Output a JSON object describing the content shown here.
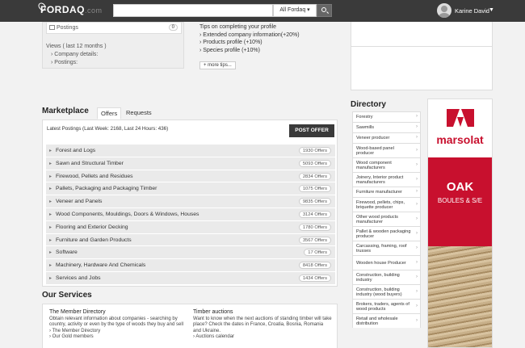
{
  "header": {
    "logo": "FORDAQ",
    "logo_domain": ".com",
    "search_placeholder": "",
    "search_scope": "All Fordaq",
    "user_name": "Karine David"
  },
  "profile": {
    "postings_label": "Postings",
    "postings_count": "0",
    "views_title": "Views ( last 12 months )",
    "views_items": [
      "Company details:",
      "Postings:"
    ]
  },
  "tips": {
    "title": "Tips on completing your profile",
    "items": [
      "Extended company information(+20%)",
      "Products profile (+10%)",
      "Species profile (+10%)"
    ],
    "more_label": "+ more tips..."
  },
  "marketplace": {
    "title": "Marketplace",
    "tabs": [
      "Offers",
      "Requests"
    ],
    "latest": "Latest Postings (Last Week: 2168, Last 24 Hours: 436)",
    "post_offer": "POST OFFER",
    "categories": [
      {
        "name": "Forest and Logs",
        "offers": "1930 Offers"
      },
      {
        "name": "Sawn and Structural Timber",
        "offers": "5093 Offers"
      },
      {
        "name": "Firewood, Pellets and Residues",
        "offers": "2834 Offers"
      },
      {
        "name": "Pallets, Packaging and Packaging Timber",
        "offers": "1075 Offers"
      },
      {
        "name": "Veneer and Panels",
        "offers": "9835 Offers"
      },
      {
        "name": "Wood Components, Mouldings, Doors & Windows, Houses",
        "offers": "3124 Offers"
      },
      {
        "name": "Flooring and Exterior Decking",
        "offers": "1780 Offers"
      },
      {
        "name": "Furniture and Garden Products",
        "offers": "3567 Offers"
      },
      {
        "name": "Software",
        "offers": "17 Offers"
      },
      {
        "name": "Machinery, Hardware And Chemicals",
        "offers": "8418 Offers"
      },
      {
        "name": "Services and Jobs",
        "offers": "1434 Offers"
      }
    ]
  },
  "services": {
    "title": "Our Services",
    "blocks": [
      {
        "title": "The Member Directory",
        "text": "Obtain relevant information about companies - searching by country, activity or even by the type of woods they buy and sell",
        "links": [
          "The Member Directory",
          "Our Gold members"
        ]
      },
      {
        "title": "Timber auctions",
        "text": "Want to know when the next auctions of standing timber will take place? Check the dates in France, Croatia, Bosnia, Romania and Ukraine.",
        "links": [
          "Auctions calendar"
        ]
      }
    ]
  },
  "directory": {
    "title": "Directory",
    "items": [
      "Forestry",
      "Sawmills",
      "Veneer producer",
      "Wood-based panel producer",
      "Wood component manufacturers",
      "Joinery, Interior product manufacturers",
      "Furniture manufacturer",
      "Firewood, pellets, chips, briquette producer",
      "Other wood products manufacturer",
      "Pallet & wooden packaging producer",
      "Carcassing, framing, roof trusses",
      "Wooden house Producer",
      "Construction, building industry",
      "Construction, building industry (wood buyers)",
      "Brokers, traders, agents of wood products",
      "Retail and wholesale distribution"
    ]
  },
  "ad": {
    "brand": "marsolat",
    "headline": "OAK",
    "subline": "BOULES & S/E",
    "brand_color": "#c8102e"
  }
}
